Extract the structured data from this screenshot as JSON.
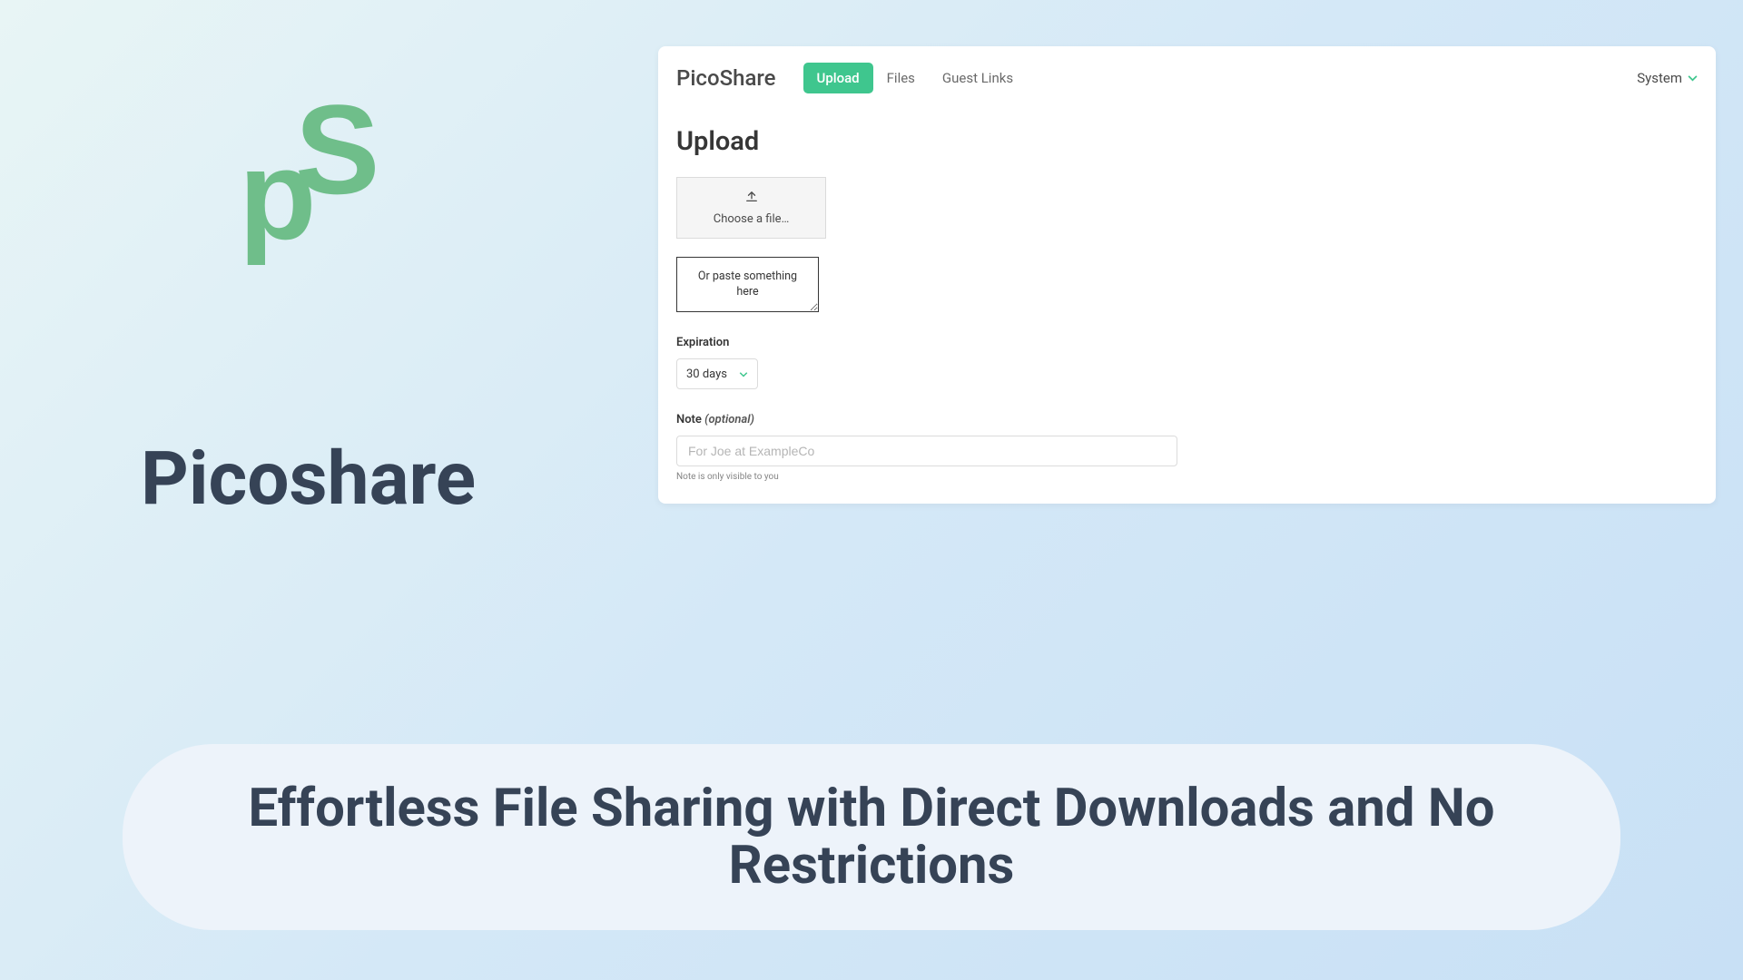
{
  "hero": {
    "title": "Picoshare",
    "logo_p": "p",
    "logo_s": "S"
  },
  "app": {
    "brand": "PicoShare",
    "nav": {
      "upload": "Upload",
      "files": "Files",
      "guest_links": "Guest Links",
      "system": "System"
    },
    "upload": {
      "heading": "Upload",
      "choose_file": "Choose a file…",
      "paste_placeholder": "Or paste something here",
      "expiration_label": "Expiration",
      "expiration_value": "30 days",
      "note_label": "Note",
      "note_optional": "(optional)",
      "note_placeholder": "For Joe at ExampleCo",
      "note_hint": "Note is only visible to you"
    }
  },
  "tagline": "Effortless File Sharing with Direct Downloads and No Restrictions"
}
